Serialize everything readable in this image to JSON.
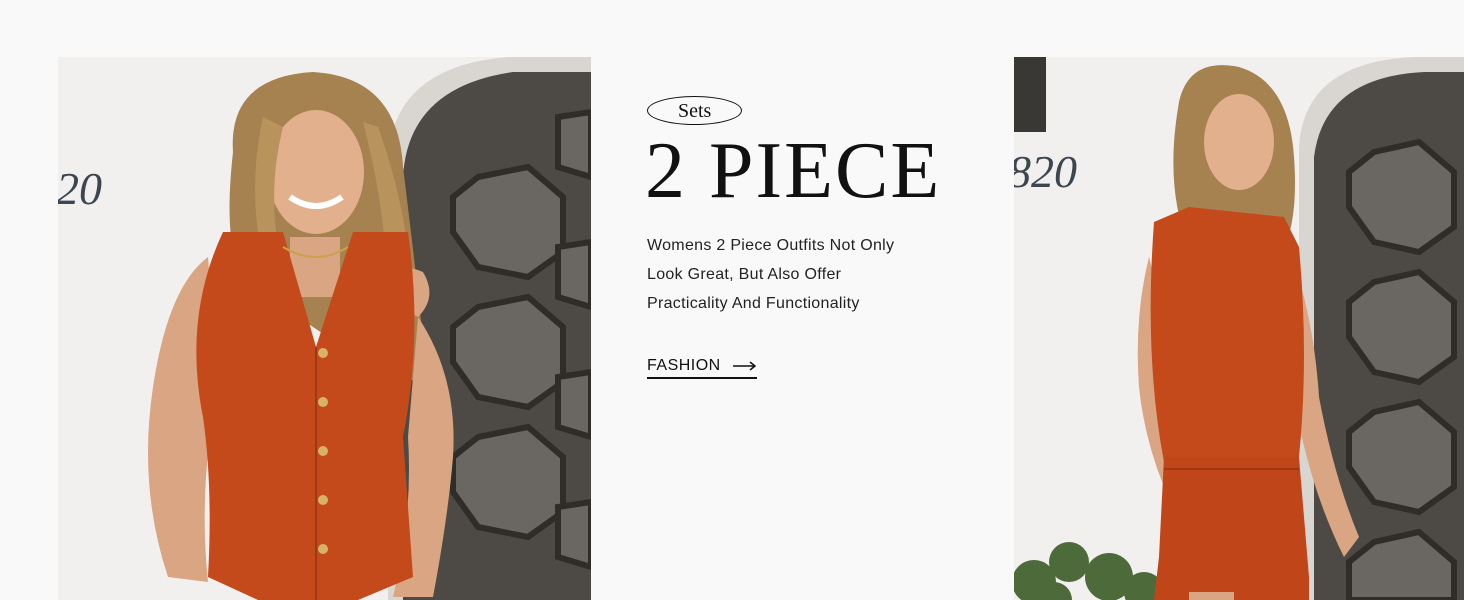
{
  "banner": {
    "tag_label": "Sets",
    "headline": "2 PIECE",
    "description_lines": [
      "Womens 2 Piece Outfits Not Only",
      "Look Great, But Also Offer",
      "Practicality And Functionality"
    ],
    "cta_label": "FASHION",
    "cta_icon": "arrow-right-icon"
  },
  "photos": {
    "left": {
      "house_number": "20",
      "subject": "woman-front-vest"
    },
    "right": {
      "house_number": "820",
      "subject": "woman-back-vest"
    }
  },
  "colors": {
    "page_background": "#f9f9f9",
    "outfit_orange": "#c44a1c",
    "wall_white": "#f1f0ee",
    "door_gray": "#4d4a46",
    "text_dark": "#111111"
  }
}
